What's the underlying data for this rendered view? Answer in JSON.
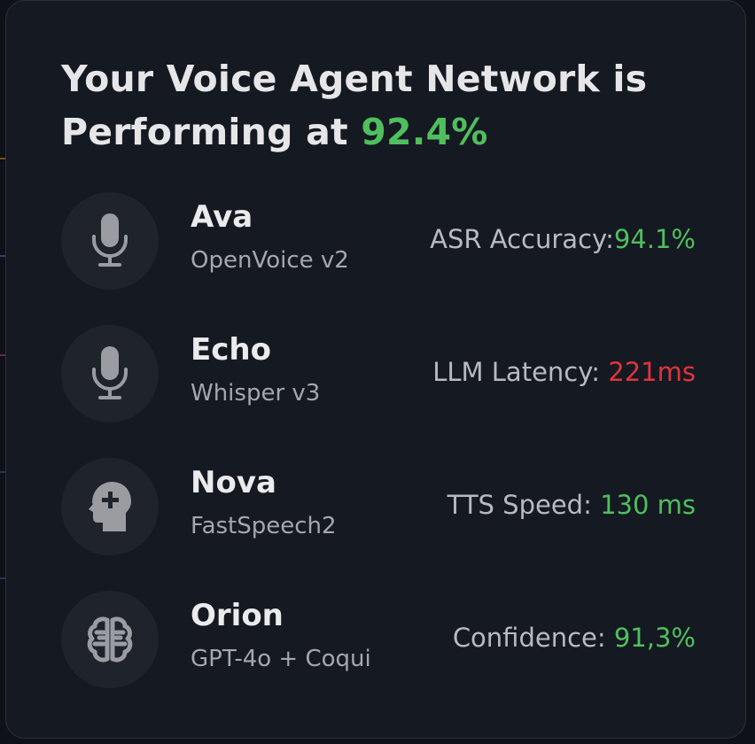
{
  "header": {
    "title_prefix": "Your Voice Agent Network is Performing at",
    "performance_value": "92.4%"
  },
  "agents": [
    {
      "name": "Ava",
      "model": "OpenVoice v2",
      "icon": "microphone-icon",
      "metric_label": "ASR Accuracy:",
      "metric_value": "94.1%",
      "metric_status": "good"
    },
    {
      "name": "Echo",
      "model": "Whisper v3",
      "icon": "microphone-icon",
      "metric_label": "LLM Latency:",
      "metric_value": "221ms",
      "metric_status": "bad"
    },
    {
      "name": "Nova",
      "model": "FastSpeech2",
      "icon": "head-plus-icon",
      "metric_label": "TTS Speed:",
      "metric_value": "130 ms",
      "metric_status": "good"
    },
    {
      "name": "Orion",
      "model": "GPT-4o + Coqui",
      "icon": "brain-icon",
      "metric_label": "Confidence:",
      "metric_value": "91,3%",
      "metric_status": "good"
    }
  ],
  "colors": {
    "good": "#4fbf5e",
    "bad": "#e0343b",
    "card_background": "#151922"
  }
}
